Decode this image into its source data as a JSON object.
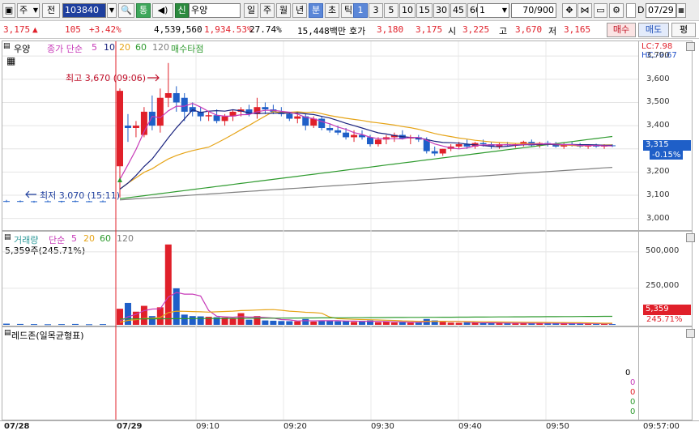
{
  "toolbar": {
    "market": "주",
    "all": "전",
    "code": "103840",
    "tong": "통",
    "sin": "신",
    "name": "우양",
    "periods": [
      "일",
      "주",
      "월",
      "년",
      "분",
      "초",
      "틱"
    ],
    "selected_period": "분",
    "intervals": [
      "1",
      "3",
      "5",
      "10",
      "15",
      "30",
      "45",
      "60"
    ],
    "selected_interval": "1",
    "interval_select": "1",
    "count": "70",
    "total": "/900",
    "date": "07/29"
  },
  "quote": {
    "price": "3,175",
    "arrow": "▲",
    "change": "105",
    "change_pct": "+3.42%",
    "volume": "4,539,560",
    "volume_ratio": "1,934.53%",
    "turnover": "27.74%",
    "amount": "15,448백만",
    "ask_label": "호가",
    "ask": "3,180",
    "bid": "3,175",
    "open_label": "시",
    "open": "3,225",
    "high_label": "고",
    "high": "3,670",
    "low_label": "저",
    "low": "3,165",
    "buy": "매수",
    "sell": "매도",
    "eval": "평"
  },
  "price_panel": {
    "stock": "우양",
    "legend_title": "종가 단순",
    "ma_periods": [
      "5",
      "10",
      "20",
      "60",
      "120"
    ],
    "signal": "매수타점",
    "lc": "LC:7.98",
    "hc": "HC:-9.67",
    "max_label": "최고 3,670 (09:06)",
    "min_label": "최저 3,070 (15:11)",
    "current_price": "3,315",
    "current_pct": "-0.15%",
    "y_ticks": [
      "3,700",
      "3,600",
      "3,500",
      "3,400",
      "3,300",
      "3,200",
      "3,100",
      "3,000"
    ]
  },
  "volume_panel": {
    "legend_title": "거래량",
    "legend_type": "단순",
    "ma_periods": [
      "5",
      "20",
      "60",
      "120"
    ],
    "current": "5,359주(245.71%)",
    "y_ticks": [
      "500,000",
      "250,000"
    ],
    "current_value": "5,359",
    "current_pct": "245.71%"
  },
  "redzone_panel": {
    "title": "레드존(일목균형표)",
    "values": [
      "0",
      "0",
      "0",
      "0",
      "0"
    ]
  },
  "time_axis": [
    "07/28",
    "07/29",
    "09:10",
    "09:20",
    "09:30",
    "09:40",
    "09:50",
    "09:57:00"
  ],
  "colors": {
    "up": "#e0202a",
    "down": "#1f5fc8",
    "ma5": "#c73ab8",
    "ma10": "#1a237e",
    "ma20": "#e6a417",
    "ma60": "#2e9a2e",
    "ma120": "#808080"
  },
  "chart_data": {
    "type": "candlestick",
    "price_range": [
      2950,
      3760
    ],
    "volume_range": [
      0,
      560000
    ],
    "x_labels": [
      "07/28",
      "07/29",
      "09:10",
      "09:20",
      "09:30",
      "09:40",
      "09:50"
    ],
    "candles": [
      [
        3075,
        3080,
        3070,
        3075,
        8000
      ],
      [
        3075,
        3078,
        3070,
        3072,
        6000
      ],
      [
        3072,
        3076,
        3068,
        3074,
        5000
      ],
      [
        3074,
        3078,
        3070,
        3072,
        4000
      ],
      [
        3072,
        3076,
        3068,
        3075,
        5000
      ],
      [
        3075,
        3078,
        3070,
        3073,
        6000
      ],
      [
        3073,
        3076,
        3070,
        3074,
        4000
      ],
      [
        3074,
        3078,
        3070,
        3071,
        5000
      ],
      [
        3225,
        3560,
        3090,
        3550,
        110000
      ],
      [
        3400,
        3450,
        3330,
        3390,
        150000
      ],
      [
        3390,
        3420,
        3350,
        3400,
        90000
      ],
      [
        3360,
        3480,
        3350,
        3460,
        130000
      ],
      [
        3460,
        3530,
        3380,
        3400,
        60000
      ],
      [
        3400,
        3560,
        3370,
        3520,
        120000
      ],
      [
        3520,
        3670,
        3480,
        3540,
        550000
      ],
      [
        3540,
        3570,
        3460,
        3500,
        250000
      ],
      [
        3520,
        3540,
        3420,
        3460,
        70000
      ],
      [
        3480,
        3500,
        3440,
        3460,
        60000
      ],
      [
        3460,
        3480,
        3420,
        3440,
        58000
      ],
      [
        3440,
        3460,
        3420,
        3445,
        55000
      ],
      [
        3445,
        3470,
        3410,
        3420,
        52000
      ],
      [
        3420,
        3450,
        3400,
        3440,
        50000
      ],
      [
        3440,
        3470,
        3420,
        3460,
        45000
      ],
      [
        3460,
        3480,
        3440,
        3470,
        80000
      ],
      [
        3470,
        3490,
        3440,
        3450,
        35000
      ],
      [
        3450,
        3520,
        3430,
        3480,
        60000
      ],
      [
        3480,
        3500,
        3450,
        3470,
        30000
      ],
      [
        3470,
        3490,
        3450,
        3460,
        28000
      ],
      [
        3460,
        3480,
        3440,
        3450,
        26000
      ],
      [
        3450,
        3460,
        3420,
        3430,
        25000
      ],
      [
        3430,
        3460,
        3410,
        3440,
        24000
      ],
      [
        3440,
        3450,
        3380,
        3400,
        40000
      ],
      [
        3400,
        3440,
        3390,
        3430,
        22000
      ],
      [
        3430,
        3440,
        3380,
        3390,
        30000
      ],
      [
        3390,
        3410,
        3370,
        3380,
        26000
      ],
      [
        3380,
        3400,
        3360,
        3370,
        24000
      ],
      [
        3370,
        3390,
        3340,
        3350,
        28000
      ],
      [
        3350,
        3380,
        3330,
        3360,
        20000
      ],
      [
        3360,
        3380,
        3340,
        3350,
        22000
      ],
      [
        3350,
        3360,
        3310,
        3320,
        30000
      ],
      [
        3320,
        3350,
        3310,
        3340,
        18000
      ],
      [
        3340,
        3360,
        3320,
        3350,
        20000
      ],
      [
        3350,
        3370,
        3330,
        3360,
        16000
      ],
      [
        3360,
        3380,
        3340,
        3345,
        18000
      ],
      [
        3345,
        3360,
        3320,
        3350,
        15000
      ],
      [
        3350,
        3360,
        3330,
        3340,
        16000
      ],
      [
        3340,
        3350,
        3280,
        3290,
        40000
      ],
      [
        3290,
        3310,
        3270,
        3280,
        30000
      ],
      [
        3280,
        3300,
        3270,
        3300,
        20000
      ],
      [
        3300,
        3320,
        3290,
        3310,
        15000
      ],
      [
        3310,
        3330,
        3300,
        3320,
        14000
      ],
      [
        3320,
        3340,
        3300,
        3310,
        16000
      ],
      [
        3310,
        3330,
        3300,
        3325,
        14000
      ],
      [
        3325,
        3340,
        3310,
        3320,
        12000
      ],
      [
        3320,
        3330,
        3300,
        3310,
        13000
      ],
      [
        3310,
        3325,
        3300,
        3320,
        11000
      ],
      [
        3320,
        3330,
        3310,
        3315,
        12000
      ],
      [
        3315,
        3325,
        3305,
        3320,
        10000
      ],
      [
        3320,
        3335,
        3310,
        3330,
        14000
      ],
      [
        3330,
        3340,
        3310,
        3315,
        12000
      ],
      [
        3315,
        3330,
        3305,
        3325,
        10000
      ],
      [
        3325,
        3335,
        3310,
        3320,
        11000
      ],
      [
        3320,
        3330,
        3305,
        3310,
        12000
      ],
      [
        3310,
        3325,
        3300,
        3320,
        9000
      ],
      [
        3320,
        3330,
        3310,
        3315,
        10000
      ],
      [
        3315,
        3325,
        3305,
        3310,
        8000
      ],
      [
        3310,
        3320,
        3300,
        3315,
        9000
      ],
      [
        3315,
        3322,
        3305,
        3310,
        7000
      ],
      [
        3310,
        3320,
        3300,
        3315,
        8000
      ],
      [
        3315,
        3320,
        3308,
        3312,
        5359
      ]
    ]
  }
}
